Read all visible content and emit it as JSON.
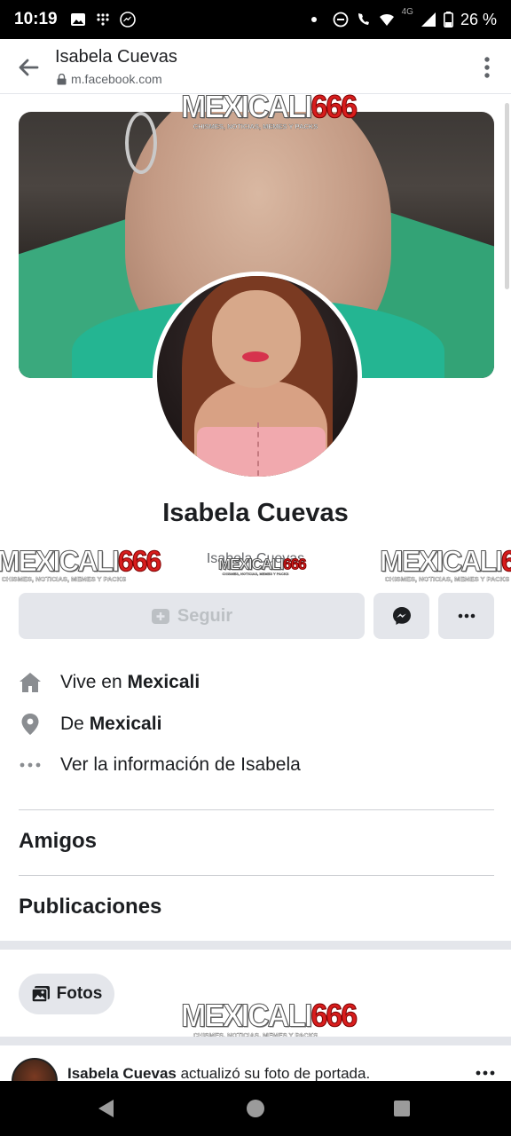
{
  "status_bar": {
    "time": "10:19",
    "network_label": "4G",
    "battery_percent": "26 %",
    "left_icons": [
      "image-icon",
      "dialpad-icon",
      "messenger-icon"
    ],
    "right_icons": [
      "dot-icon",
      "dnd-icon",
      "volte-call-icon",
      "wifi-icon",
      "signal-icon",
      "battery-icon"
    ]
  },
  "browser": {
    "title": "Isabela Cuevas",
    "url": "m.facebook.com"
  },
  "watermark": {
    "brand_left": "MEXICALI",
    "brand_right": "666",
    "tagline": "CHISMES, NOTICIAS, MEMES Y PACKS"
  },
  "profile": {
    "name": "Isabela Cuevas",
    "subname": "Isabela Cuevas",
    "follow_label": "Seguir"
  },
  "info": {
    "lives_prefix": "Vive en ",
    "lives_city": "Mexicali",
    "from_prefix": "De ",
    "from_city": "Mexicali",
    "see_info": "Ver la información de Isabela"
  },
  "sections": {
    "friends": "Amigos",
    "posts": "Publicaciones"
  },
  "photos_pill": "Fotos",
  "post": {
    "author": "Isabela Cuevas",
    "action": " actualizó su foto de portada."
  },
  "colors": {
    "accent_gray": "#e4e6eb",
    "disabled_text": "#bcc0c4",
    "watermark_red": "#d81d1d"
  }
}
